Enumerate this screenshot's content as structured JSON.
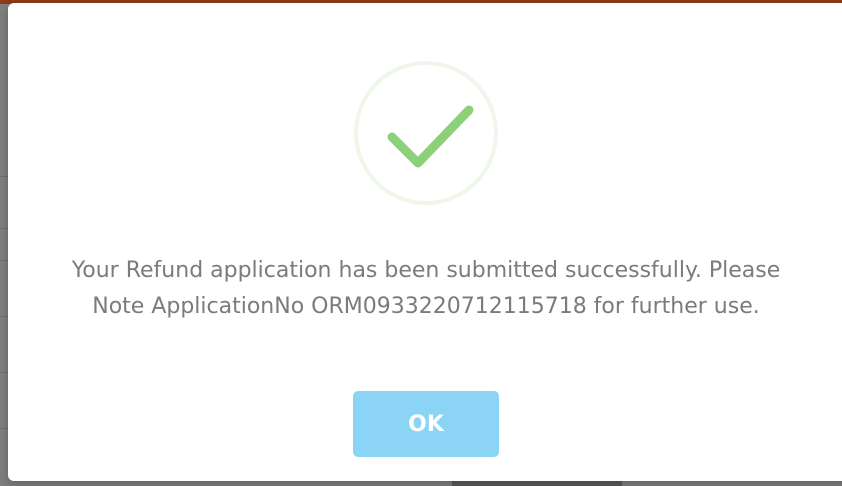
{
  "dialog": {
    "message_line1": "Your Refund application has been submitted successfully. Please",
    "message_line2": "Note ApplicationNo ORM0933220712115718 for further use.",
    "ok_label": "OK",
    "icon": "checkmark-icon"
  },
  "colors": {
    "check": "#8cd17a",
    "ok_button": "#8cd4f5",
    "message_text": "#7b7b7b",
    "top_bar": "#8e3b16"
  }
}
